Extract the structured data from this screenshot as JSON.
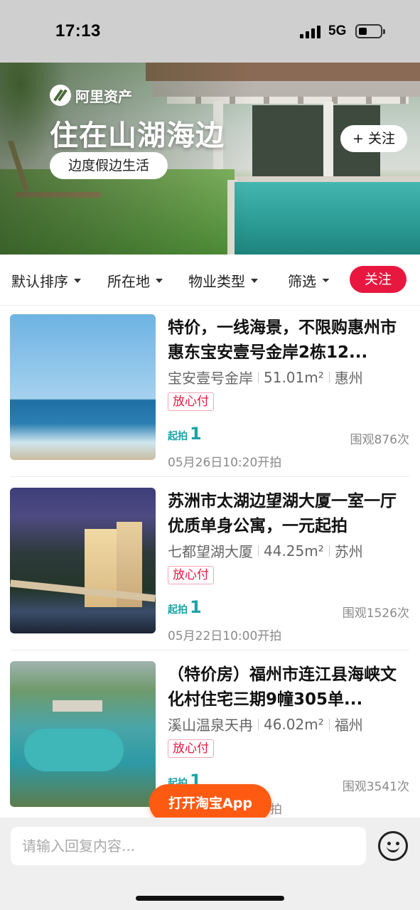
{
  "status_bar": {
    "time": "17:13",
    "network": "5G",
    "icons": [
      "signal-bars-icon",
      "battery-icon"
    ]
  },
  "banner": {
    "brand": "阿里资产",
    "title": "住在山湖海边",
    "tagline": "边度假边生活",
    "follow_label": "+ 关注"
  },
  "filters": {
    "items": [
      {
        "label": "默认排序",
        "icon": "caret-down-icon"
      },
      {
        "label": "所在地",
        "icon": "caret-down-icon"
      },
      {
        "label": "物业类型",
        "icon": "caret-down-icon"
      },
      {
        "label": "筛选",
        "icon": "funnel-icon"
      }
    ],
    "follow_label": "关注",
    "follow_color": "#e8173f"
  },
  "listings": [
    {
      "title": "特价，一线海景，不限购惠州市惠东宝安壹号金岸2栋12...",
      "community": "宝安壹号金岸",
      "area": "51.01m²",
      "city": "惠州",
      "badge": "放心付",
      "start_label": "起拍",
      "start_price": "1",
      "views": "围观876次",
      "time": "05月26日10:20开拍"
    },
    {
      "title": "苏洲市太湖边望湖大厦一室一厅优质单身公寓，一元起拍",
      "community": "七都望湖大厦",
      "area": "44.25m²",
      "city": "苏州",
      "badge": "放心付",
      "start_label": "起拍",
      "start_price": "1",
      "views": "围观1526次",
      "time": "05月22日10:00开拍"
    },
    {
      "title": "（特价房）福州市连江县海峡文化村住宅三期9幢305单...",
      "community": "溪山温泉天冉",
      "area": "46.02m²",
      "city": "福州",
      "badge": "放心付",
      "start_label": "起拍",
      "start_price": "1",
      "views": "围观3541次",
      "time": "拍"
    }
  ],
  "open_app": {
    "label": "打开淘宝App",
    "color": "#ff5a12"
  },
  "reply_bar": {
    "placeholder": "请输入回复内容...",
    "emoji_icon": "smiley-icon"
  },
  "colors": {
    "accent_red": "#e8173f",
    "start_price_teal": "#1aa3a8"
  }
}
